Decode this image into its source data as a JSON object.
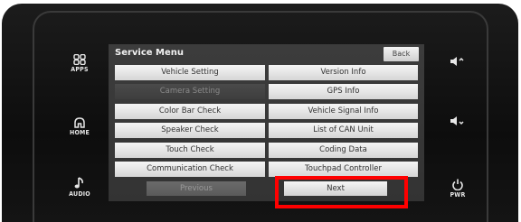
{
  "side_left": [
    {
      "label": "APPS",
      "icon": "apps-icon"
    },
    {
      "label": "HOME",
      "icon": "home-icon"
    },
    {
      "label": "AUDIO",
      "icon": "music-note-icon"
    }
  ],
  "side_right": [
    {
      "label": "",
      "icon": "volume-up-icon"
    },
    {
      "label": "",
      "icon": "volume-down-icon"
    },
    {
      "label": "PWR",
      "icon": "power-icon"
    }
  ],
  "menu": {
    "title": "Service Menu",
    "back_label": "Back",
    "left_items": [
      {
        "label": "Vehicle Setting",
        "enabled": true
      },
      {
        "label": "Camera Setting",
        "enabled": false
      },
      {
        "label": "Color Bar Check",
        "enabled": true
      },
      {
        "label": "Speaker Check",
        "enabled": true
      },
      {
        "label": "Touch Check",
        "enabled": true
      },
      {
        "label": "Communication Check",
        "enabled": true
      }
    ],
    "right_items": [
      {
        "label": "Version Info",
        "enabled": true
      },
      {
        "label": "GPS Info",
        "enabled": true
      },
      {
        "label": "Vehicle Signal Info",
        "enabled": true
      },
      {
        "label": "List of CAN Unit",
        "enabled": true
      },
      {
        "label": "Coding Data",
        "enabled": true
      },
      {
        "label": "Touchpad Controller",
        "enabled": true
      }
    ],
    "previous_label": "Previous",
    "next_label": "Next"
  },
  "highlight_color": "#ff0000"
}
